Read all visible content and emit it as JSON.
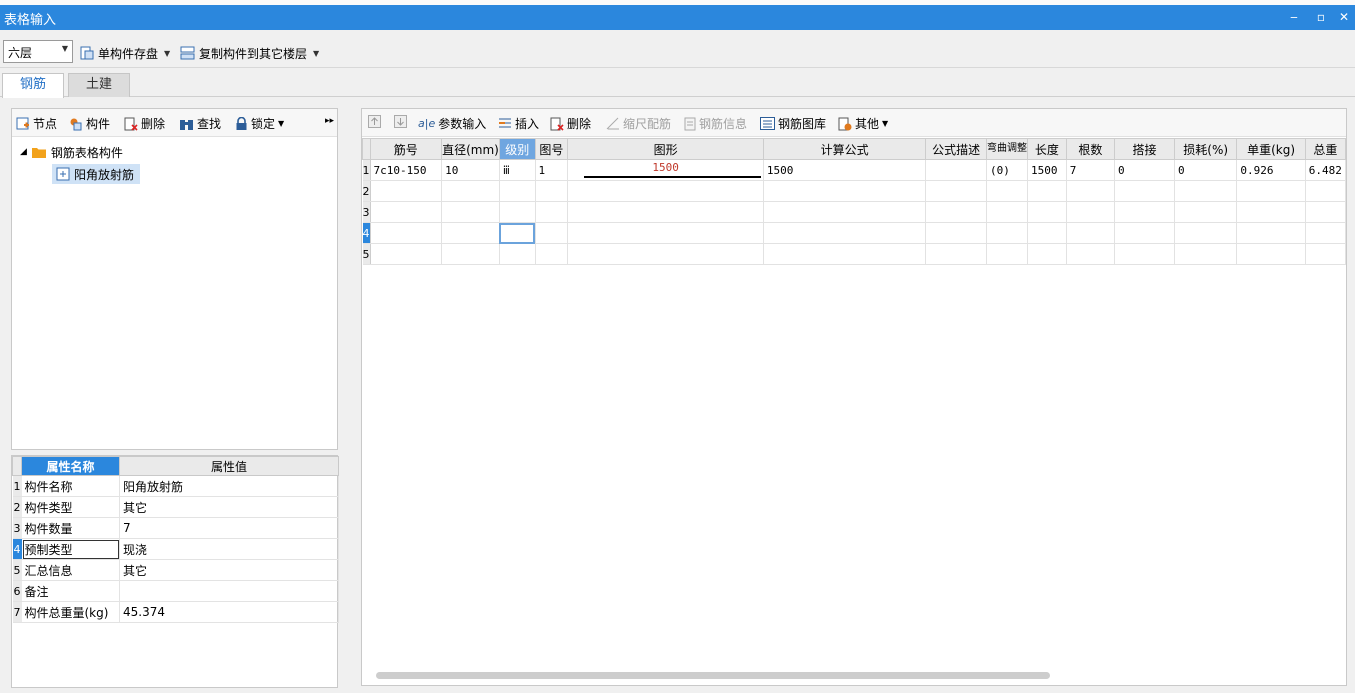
{
  "window": {
    "title": "表格输入"
  },
  "toolbar": {
    "floor": "六层",
    "save_component": "单构件存盘",
    "copy_to_floor": "复制构件到其它楼层"
  },
  "tabs": [
    {
      "label": "钢筋"
    },
    {
      "label": "土建"
    }
  ],
  "tree_toolbar": {
    "node": "节点",
    "component": "构件",
    "delete": "删除",
    "find": "查找",
    "lock": "锁定"
  },
  "tree": {
    "root": "钢筋表格构件",
    "child": "阳角放射筋"
  },
  "properties": {
    "header_name": "属性名称",
    "header_value": "属性值",
    "rows": [
      {
        "idx": "1",
        "name": "构件名称",
        "value": "阳角放射筋"
      },
      {
        "idx": "2",
        "name": "构件类型",
        "value": "其它"
      },
      {
        "idx": "3",
        "name": "构件数量",
        "value": "7"
      },
      {
        "idx": "4",
        "name": "预制类型",
        "value": "现浇"
      },
      {
        "idx": "5",
        "name": "汇总信息",
        "value": "其它"
      },
      {
        "idx": "6",
        "name": "备注",
        "value": ""
      },
      {
        "idx": "7",
        "name": "构件总重量(kg)",
        "value": "45.374"
      }
    ]
  },
  "grid_toolbar": {
    "param_input": "参数输入",
    "insert": "插入",
    "delete": "删除",
    "scale_rebar": "缩尺配筋",
    "rebar_info": "钢筋信息",
    "rebar_library": "钢筋图库",
    "other": "其他"
  },
  "grid": {
    "headers": [
      "筋号",
      "直径(mm)",
      "级别",
      "图号",
      "图形",
      "计算公式",
      "公式描述",
      "弯曲调整",
      "长度",
      "根数",
      "搭接",
      "损耗(%)",
      "单重(kg)",
      "总重"
    ],
    "rows": [
      {
        "idx": "1",
        "cells": [
          "7c10-150",
          "10",
          "ⅲ",
          "1",
          "1500",
          "1500",
          "",
          "(0)",
          "1500",
          "7",
          "0",
          "0",
          "0.926",
          "6.482"
        ]
      },
      {
        "idx": "2",
        "cells": [
          "",
          "",
          "",
          "",
          "",
          "",
          "",
          "",
          "",
          "",
          "",
          "",
          "",
          ""
        ]
      },
      {
        "idx": "3",
        "cells": [
          "",
          "",
          "",
          "",
          "",
          "",
          "",
          "",
          "",
          "",
          "",
          "",
          "",
          ""
        ]
      },
      {
        "idx": "4",
        "cells": [
          "",
          "",
          "",
          "",
          "",
          "",
          "",
          "",
          "",
          "",
          "",
          "",
          "",
          ""
        ]
      },
      {
        "idx": "5",
        "cells": [
          "",
          "",
          "",
          "",
          "",
          "",
          "",
          "",
          "",
          "",
          "",
          "",
          "",
          ""
        ]
      }
    ]
  }
}
